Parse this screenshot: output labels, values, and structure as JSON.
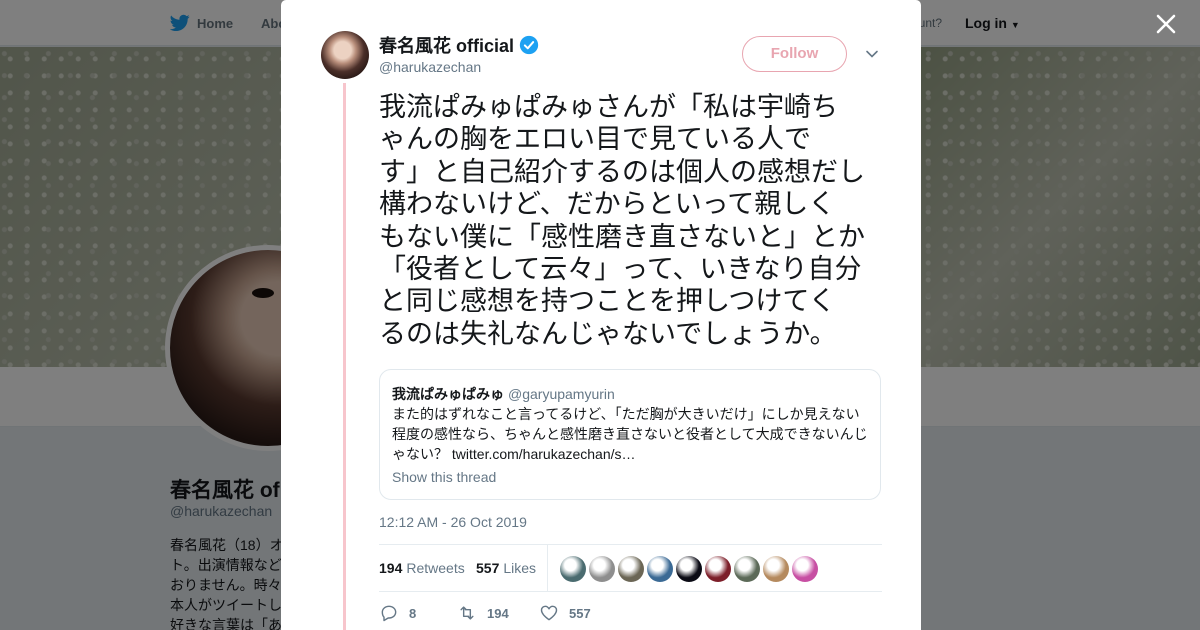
{
  "nav": {
    "home_label": "Home",
    "about_label": "Abo",
    "have_account": "ccount?",
    "login_label": "Log in"
  },
  "profile": {
    "name": "春名風花 of",
    "handle": "@harukazechan",
    "bio_lines": [
      "春名風花（18）オ",
      "ト。出演情報など",
      "おりません。時々",
      "本人がツイートし",
      "好きな言葉は「あ"
    ]
  },
  "tweet": {
    "author_name": "春名風花 official",
    "author_handle": "@harukazechan",
    "follow_label": "Follow",
    "text_lines": [
      "我流ぱみゅぱみゅさんが「私は宇崎ち",
      "ゃんの胸をエロい目で見ている人で",
      "す」と自己紹介するのは個人の感想だし",
      "構わないけど、だからといって親しく",
      "もない僕に「感性磨き直さないと」とか",
      "「役者として云々」って、いきなり自分",
      "と同じ感想を持つことを押しつけてく",
      "るのは失礼なんじゃないでしょうか。"
    ],
    "quote": {
      "name": "我流ぱみゅぱみゅ",
      "handle": "@garyupamyurin",
      "body_lines": [
        "また的はずれなこと言ってるけど、「ただ胸が大きいだけ」にしか見えない",
        "程度の感性なら、ちゃんと感性磨き直さないと役者として大成できないんじ",
        "ゃない？ twitter.com/harukazechan/s…"
      ],
      "show_thread": "Show this thread"
    },
    "timestamp": "12:12 AM - 26 Oct 2019",
    "retweets_count": "194",
    "retweets_label": "Retweets",
    "likes_count": "557",
    "likes_label": "Likes",
    "actions": {
      "reply_count": "8",
      "retweet_count": "194",
      "like_count": "557"
    }
  },
  "colors": {
    "accent": "#1da1f2",
    "follow_pink": "#e8a5b0",
    "thread_line": "#f7c5cc",
    "liker_avatars": [
      "#4a6b6f",
      "#8e8e8e",
      "#6b6655",
      "#3b6a95",
      "#0a0a14",
      "#7d1f2a",
      "#5c6a58",
      "#b58a5e",
      "#c74fa3"
    ]
  }
}
